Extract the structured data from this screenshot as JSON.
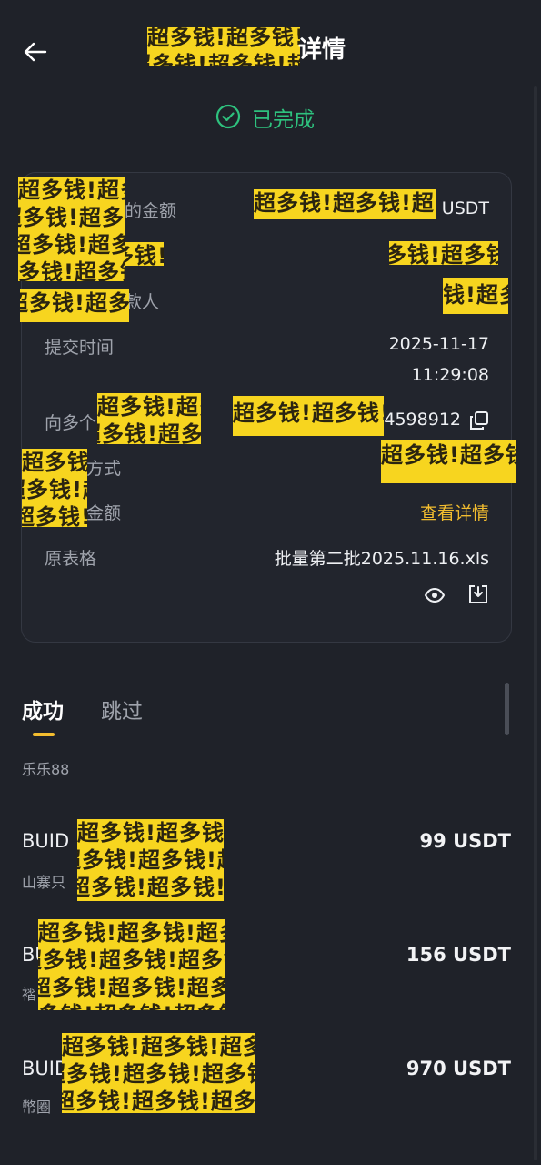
{
  "header": {
    "title_suffix": "详情",
    "back_icon": "arrow-left-icon"
  },
  "status": {
    "text": "已完成",
    "color": "#2ec27e",
    "icon": "check-circle-icon"
  },
  "details": {
    "amount_label_partial": "的金额",
    "amount_unit": "USDT",
    "payer_label_partial": "款人",
    "payee_label_partial": "款人",
    "submit_time_label": "提交时间",
    "submit_date": "2025-11-17",
    "submit_time": "11:29:08",
    "multi_label_partial": "向多个",
    "multi_value_partial": "4598912",
    "method_label_partial": "方式",
    "total_label_partial": "金额",
    "view_details": "查看详情",
    "original_sheet_label": "原表格",
    "original_sheet_file": "批量第二批2025.11.16.xls"
  },
  "tabs": [
    {
      "label": "成功",
      "active": true
    },
    {
      "label": "跳过",
      "active": false
    }
  ],
  "group_label": "乐乐88",
  "rows": [
    {
      "title_partial": "BUID",
      "sub_partial": "山寨只",
      "amount": "99 USDT"
    },
    {
      "title_partial": "BU",
      "sub_partial": "褶",
      "amount": "156 USDT"
    },
    {
      "title_partial": "BUID",
      "sub_partial": "幣圈",
      "amount": "970 USDT"
    }
  ],
  "redaction_pattern": "超多钱!超多钱!超多钱!超多钱!",
  "accent_color": "#f3bd2f"
}
